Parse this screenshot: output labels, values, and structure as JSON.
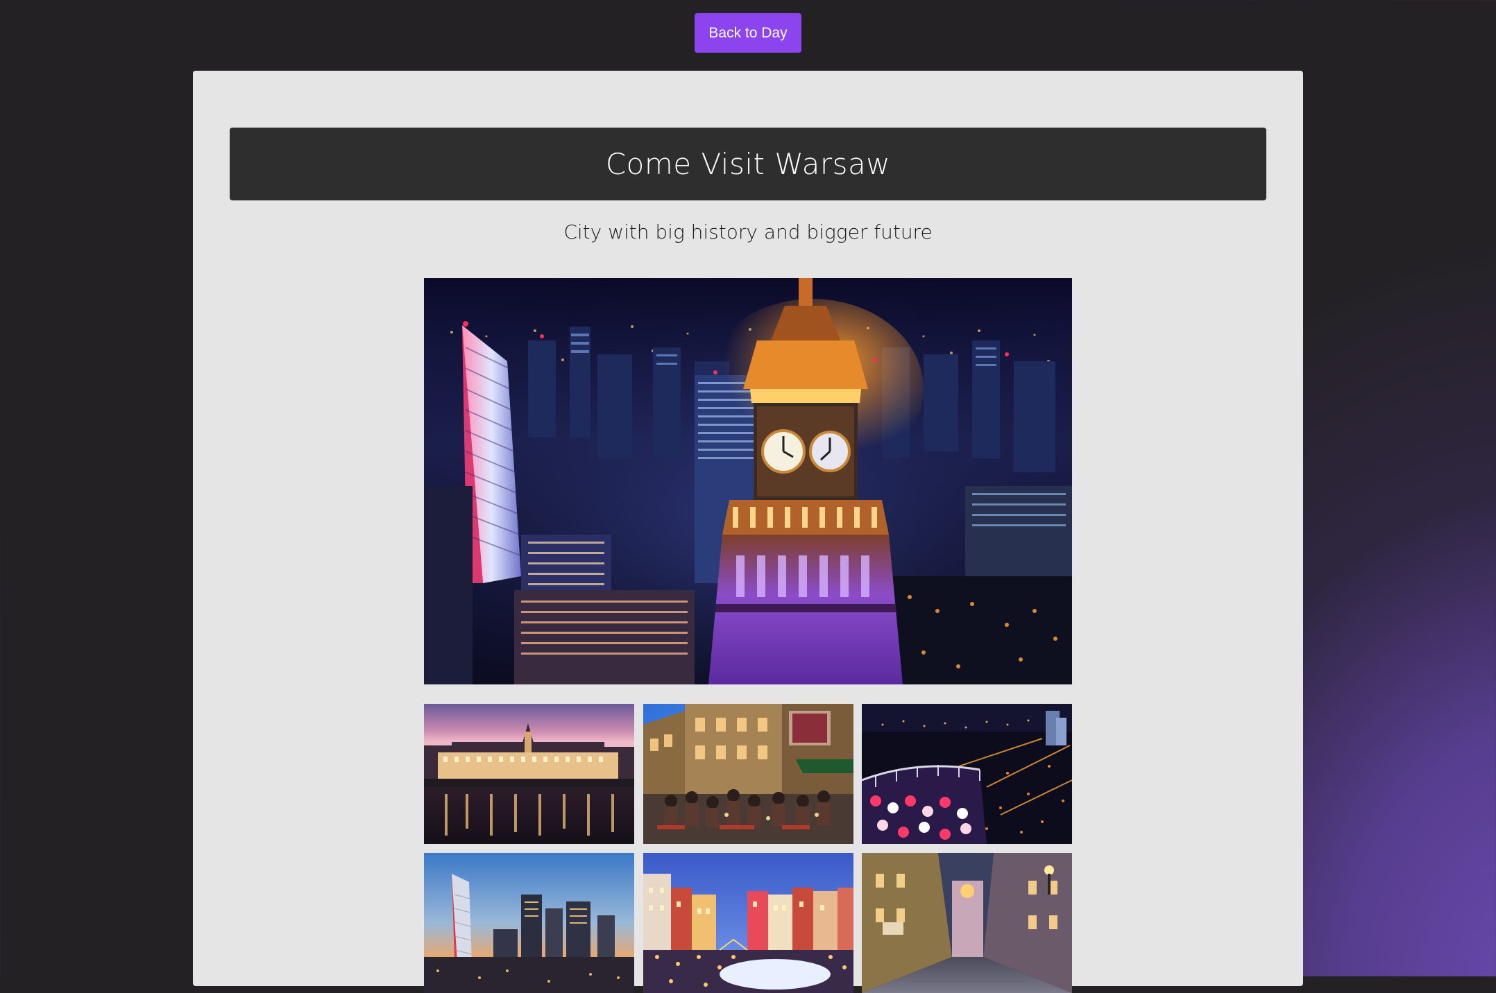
{
  "toolbar": {
    "back_label": "Back to Day"
  },
  "header": {
    "title": "Come Visit Warsaw",
    "subtitle": "City with big history and bigger future"
  },
  "gallery": {
    "hero": {
      "name": "palace-of-culture-night-photo"
    },
    "thumbnails": [
      {
        "name": "royal-castle-river-photo"
      },
      {
        "name": "old-town-street-cafe-photo"
      },
      {
        "name": "rooftop-party-night-photo"
      },
      {
        "name": "skyline-sunset-photo"
      },
      {
        "name": "market-square-christmas-photo"
      },
      {
        "name": "old-town-alley-photo"
      }
    ]
  },
  "colors": {
    "background": "#232123",
    "accent": "#8c44ee",
    "panel": "#e5e5e5",
    "title_bar": "#2e2e2e",
    "corner_glow": "#6e4cb9"
  }
}
